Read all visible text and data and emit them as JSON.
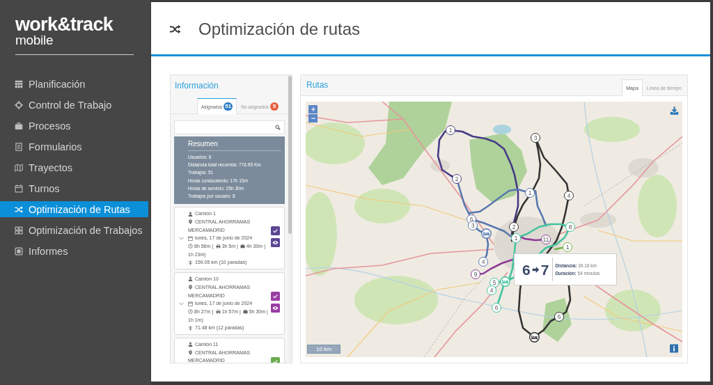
{
  "sidebar": {
    "logo": {
      "name": "work&track",
      "subtitle": "mobile"
    },
    "items": [
      {
        "label": "Planificación",
        "selected": false
      },
      {
        "label": "Control de Trabajo",
        "selected": false
      },
      {
        "label": "Procesos",
        "selected": false
      },
      {
        "label": "Formularios",
        "selected": false
      },
      {
        "label": "Trayectos",
        "selected": false
      },
      {
        "label": "Turnos",
        "selected": false
      },
      {
        "label": "Optimización de Rutas",
        "selected": true
      },
      {
        "label": "Optimización de Trabajos",
        "selected": false
      },
      {
        "label": "Informes",
        "selected": false
      }
    ]
  },
  "header": {
    "title": "Optimización de rutas"
  },
  "info_panel": {
    "title": "Información",
    "tabs": [
      {
        "label": "Asignados",
        "count": "51",
        "color": "#2f7fc3",
        "selected": true
      },
      {
        "label": "No asignados",
        "count": "5",
        "color": "#e4603f",
        "selected": false
      }
    ],
    "summary": {
      "title": "Resumen",
      "lines": [
        "Usuarios: 6",
        "Distancia total recorrida: 776.95 Km",
        "Trabajos: 51",
        "Horas conduciendo: 17h 15m",
        "Horas de servicio: 25h 30m",
        "Trabajos por usuario: 8"
      ]
    },
    "routes": [
      {
        "driver": "Camión 1",
        "location": [
          "CENTRAL AHORRAMAS",
          "MERCAMADRID"
        ],
        "date": "lunes, 17 de junio de 2024",
        "times": [
          {
            "kind": "total",
            "text": "8h 56m ("
          },
          {
            "kind": "driving",
            "text": "3h 5m |"
          },
          {
            "kind": "work",
            "text": "4h 30m |"
          },
          {
            "kind": "rest",
            "text": "1h 23m)"
          }
        ],
        "distance": "159.05 km (10 paradas)",
        "color": "#5b4594",
        "expanded": false,
        "buttons": [
          {
            "kind": "confirm"
          },
          {
            "kind": "view"
          }
        ]
      },
      {
        "driver": "Camión 10",
        "location": [
          "CENTRAL AHORRAMAS",
          "MERCAMADRID"
        ],
        "date": "lunes, 17 de junio de 2024",
        "times": [
          {
            "kind": "total",
            "text": "8h 27m ("
          },
          {
            "kind": "driving",
            "text": "1h 57m |"
          },
          {
            "kind": "work",
            "text": "5h 30m |"
          },
          {
            "kind": "rest",
            "text": "1h 1m)"
          }
        ],
        "distance": "71.48 km (12 paradas)",
        "color": "#993ea3",
        "expanded": false,
        "buttons": [
          {
            "kind": "confirm"
          },
          {
            "kind": "view"
          }
        ]
      },
      {
        "driver": "Camión 11",
        "location": [
          "CENTRAL AHORRAMAS",
          "MERCAMADRID"
        ],
        "color": "#6aab4e",
        "buttons": [
          {
            "kind": "confirm"
          }
        ]
      }
    ]
  },
  "map_panel": {
    "title": "Rutas",
    "tabs": [
      {
        "label": "Mapa",
        "selected": true
      },
      {
        "label": "Línea de tiempo",
        "selected": false
      }
    ],
    "map": {
      "routes": [
        {
          "color": "#463b84",
          "stops": [
            {
              "kind": "stop",
              "label": "1"
            },
            {
              "kind": "stop",
              "label": "2"
            }
          ]
        },
        {
          "color": "#8d3c98",
          "stops": [
            {
              "kind": "stop",
              "label": "9"
            },
            {
              "kind": "stop",
              "label": "11"
            }
          ]
        },
        {
          "color": "#5878b0",
          "stops": [
            {
              "kind": "stop",
              "label": "6"
            },
            {
              "kind": "stop",
              "label": "3"
            },
            {
              "kind": "depot"
            },
            {
              "kind": "stop",
              "label": "4"
            },
            {
              "kind": "stop",
              "label": "1"
            }
          ]
        },
        {
          "color": "#333333",
          "stops": [
            {
              "kind": "stop",
              "label": "3"
            },
            {
              "kind": "stop",
              "label": "4"
            },
            {
              "kind": "stop",
              "label": "2"
            },
            {
              "kind": "stop",
              "label": "6"
            },
            {
              "kind": "depot"
            }
          ]
        },
        {
          "color": "#45c3a0",
          "stops": [
            {
              "kind": "stop",
              "label": "1"
            },
            {
              "kind": "stop",
              "label": "8"
            },
            {
              "kind": "stop",
              "label": "5"
            },
            {
              "kind": "depot"
            },
            {
              "kind": "stop",
              "label": "4"
            },
            {
              "kind": "stop",
              "label": "6"
            }
          ]
        },
        {
          "color": "#77b34a",
          "stops": [
            {
              "kind": "stop",
              "label": "1"
            }
          ]
        }
      ],
      "popup": {
        "from": "6",
        "to": "7",
        "lines": [
          "**Distancia:** 39.16 km",
          "**Duración:** 54 minutos"
        ]
      },
      "scale": "10 km"
    }
  }
}
